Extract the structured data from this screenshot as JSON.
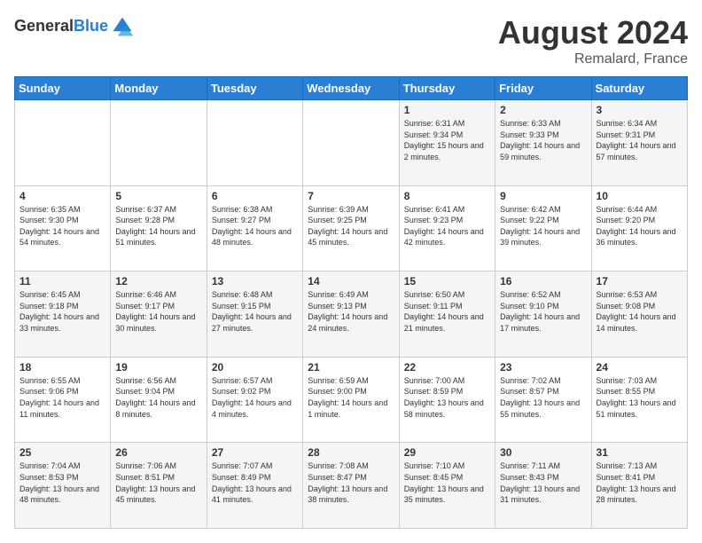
{
  "logo": {
    "line1": "General",
    "line2": "Blue"
  },
  "title": "August 2024",
  "subtitle": "Remalard, France",
  "days_of_week": [
    "Sunday",
    "Monday",
    "Tuesday",
    "Wednesday",
    "Thursday",
    "Friday",
    "Saturday"
  ],
  "weeks": [
    [
      {
        "num": "",
        "info": ""
      },
      {
        "num": "",
        "info": ""
      },
      {
        "num": "",
        "info": ""
      },
      {
        "num": "",
        "info": ""
      },
      {
        "num": "1",
        "info": "Sunrise: 6:31 AM\nSunset: 9:34 PM\nDaylight: 15 hours and 2 minutes."
      },
      {
        "num": "2",
        "info": "Sunrise: 6:33 AM\nSunset: 9:33 PM\nDaylight: 14 hours and 59 minutes."
      },
      {
        "num": "3",
        "info": "Sunrise: 6:34 AM\nSunset: 9:31 PM\nDaylight: 14 hours and 57 minutes."
      }
    ],
    [
      {
        "num": "4",
        "info": "Sunrise: 6:35 AM\nSunset: 9:30 PM\nDaylight: 14 hours and 54 minutes."
      },
      {
        "num": "5",
        "info": "Sunrise: 6:37 AM\nSunset: 9:28 PM\nDaylight: 14 hours and 51 minutes."
      },
      {
        "num": "6",
        "info": "Sunrise: 6:38 AM\nSunset: 9:27 PM\nDaylight: 14 hours and 48 minutes."
      },
      {
        "num": "7",
        "info": "Sunrise: 6:39 AM\nSunset: 9:25 PM\nDaylight: 14 hours and 45 minutes."
      },
      {
        "num": "8",
        "info": "Sunrise: 6:41 AM\nSunset: 9:23 PM\nDaylight: 14 hours and 42 minutes."
      },
      {
        "num": "9",
        "info": "Sunrise: 6:42 AM\nSunset: 9:22 PM\nDaylight: 14 hours and 39 minutes."
      },
      {
        "num": "10",
        "info": "Sunrise: 6:44 AM\nSunset: 9:20 PM\nDaylight: 14 hours and 36 minutes."
      }
    ],
    [
      {
        "num": "11",
        "info": "Sunrise: 6:45 AM\nSunset: 9:18 PM\nDaylight: 14 hours and 33 minutes."
      },
      {
        "num": "12",
        "info": "Sunrise: 6:46 AM\nSunset: 9:17 PM\nDaylight: 14 hours and 30 minutes."
      },
      {
        "num": "13",
        "info": "Sunrise: 6:48 AM\nSunset: 9:15 PM\nDaylight: 14 hours and 27 minutes."
      },
      {
        "num": "14",
        "info": "Sunrise: 6:49 AM\nSunset: 9:13 PM\nDaylight: 14 hours and 24 minutes."
      },
      {
        "num": "15",
        "info": "Sunrise: 6:50 AM\nSunset: 9:11 PM\nDaylight: 14 hours and 21 minutes."
      },
      {
        "num": "16",
        "info": "Sunrise: 6:52 AM\nSunset: 9:10 PM\nDaylight: 14 hours and 17 minutes."
      },
      {
        "num": "17",
        "info": "Sunrise: 6:53 AM\nSunset: 9:08 PM\nDaylight: 14 hours and 14 minutes."
      }
    ],
    [
      {
        "num": "18",
        "info": "Sunrise: 6:55 AM\nSunset: 9:06 PM\nDaylight: 14 hours and 11 minutes."
      },
      {
        "num": "19",
        "info": "Sunrise: 6:56 AM\nSunset: 9:04 PM\nDaylight: 14 hours and 8 minutes."
      },
      {
        "num": "20",
        "info": "Sunrise: 6:57 AM\nSunset: 9:02 PM\nDaylight: 14 hours and 4 minutes."
      },
      {
        "num": "21",
        "info": "Sunrise: 6:59 AM\nSunset: 9:00 PM\nDaylight: 14 hours and 1 minute."
      },
      {
        "num": "22",
        "info": "Sunrise: 7:00 AM\nSunset: 8:59 PM\nDaylight: 13 hours and 58 minutes."
      },
      {
        "num": "23",
        "info": "Sunrise: 7:02 AM\nSunset: 8:57 PM\nDaylight: 13 hours and 55 minutes."
      },
      {
        "num": "24",
        "info": "Sunrise: 7:03 AM\nSunset: 8:55 PM\nDaylight: 13 hours and 51 minutes."
      }
    ],
    [
      {
        "num": "25",
        "info": "Sunrise: 7:04 AM\nSunset: 8:53 PM\nDaylight: 13 hours and 48 minutes."
      },
      {
        "num": "26",
        "info": "Sunrise: 7:06 AM\nSunset: 8:51 PM\nDaylight: 13 hours and 45 minutes."
      },
      {
        "num": "27",
        "info": "Sunrise: 7:07 AM\nSunset: 8:49 PM\nDaylight: 13 hours and 41 minutes."
      },
      {
        "num": "28",
        "info": "Sunrise: 7:08 AM\nSunset: 8:47 PM\nDaylight: 13 hours and 38 minutes."
      },
      {
        "num": "29",
        "info": "Sunrise: 7:10 AM\nSunset: 8:45 PM\nDaylight: 13 hours and 35 minutes."
      },
      {
        "num": "30",
        "info": "Sunrise: 7:11 AM\nSunset: 8:43 PM\nDaylight: 13 hours and 31 minutes."
      },
      {
        "num": "31",
        "info": "Sunrise: 7:13 AM\nSunset: 8:41 PM\nDaylight: 13 hours and 28 minutes."
      }
    ]
  ]
}
